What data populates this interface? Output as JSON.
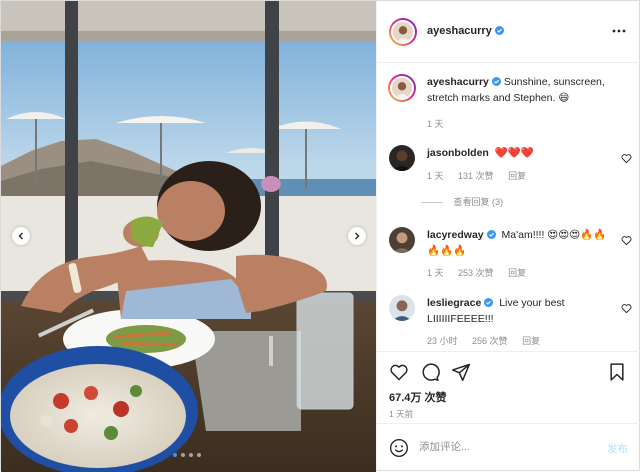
{
  "post": {
    "author": "ayeshacurry",
    "carousel_page": 1,
    "carousel_total": 4
  },
  "caption": {
    "username": "ayeshacurry",
    "text": "Sunshine, sunscreen, stretch marks and Stephen. 😄",
    "time": "1 天"
  },
  "comments": [
    {
      "username": "jasonbolden",
      "text": "❤️❤️❤️",
      "time": "1 天",
      "likes": "131 次赞",
      "reply": "回复",
      "view_replies": "查看回复 (3)"
    },
    {
      "username": "lacyredway",
      "text": "Ma'am!!!! 😍😍😍🔥🔥🔥🔥🔥",
      "time": "1 天",
      "likes": "253 次赞",
      "reply": "回复"
    },
    {
      "username": "lesliegrace",
      "text": "Live your best LIIIIIIFEEEE!!!",
      "time": "23 小时",
      "likes": "256 次赞",
      "reply": "回复"
    }
  ],
  "engagement": {
    "likes": "67.4万 次赞",
    "posted": "1 天前"
  },
  "composer": {
    "placeholder": "添加评论...",
    "post_label": "发布"
  },
  "icons": {
    "verified": "verified-badge-icon",
    "more": "more-options-icon",
    "like": "heart-icon",
    "comment": "comment-icon",
    "share": "share-icon",
    "save": "bookmark-icon",
    "emoji": "emoji-icon"
  },
  "colors": {
    "verified": "#3897f0",
    "post_button_disabled": "#b2dffc",
    "secondary_text": "#8e8e8e"
  }
}
